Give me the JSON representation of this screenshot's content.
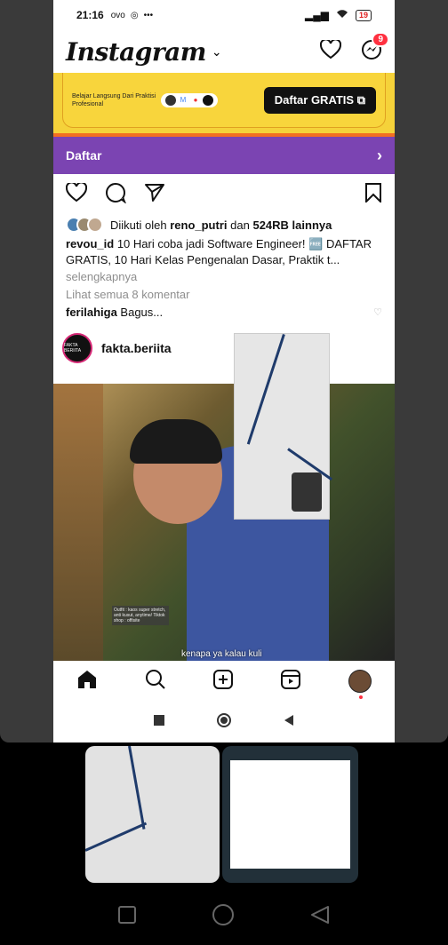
{
  "status_bar": {
    "time": "21:16",
    "carrier_icons": "ovo",
    "more": "•••",
    "battery": "19"
  },
  "header": {
    "logo": "Instagram",
    "messages_badge": "9"
  },
  "ad": {
    "tagline": "Belajar Langsung Dari Praktisi Profesional",
    "cta": "Daftar GRATIS"
  },
  "daftar_bar": {
    "label": "Daftar"
  },
  "post": {
    "liked_prefix": "Diikuti oleh",
    "liked_user": "reno_putri",
    "liked_mid": "dan",
    "liked_count": "524RB lainnya",
    "caption_user": "revou_id",
    "caption_text": "10 Hari coba jadi Software Engineer! 🆓 DAFTAR GRATIS, 10 Hari Kelas Pengenalan Dasar, Praktik t...",
    "more": "selengkapnya",
    "view_comments": "Lihat semua 8 komentar",
    "comment_user": "ferilahiga",
    "comment_text": "Bagus..."
  },
  "next_post": {
    "username": "fakta.beriita",
    "avatar_text": "FAKTA BERIITA",
    "video_subtitle": "kenapa ya kalau kuli",
    "video_sticker": "Outfit : kaos super stretch, anti kusut, anytime/ Tiktok shop : offisite"
  },
  "colors": {
    "ad_yellow": "#f5d23a",
    "ad_orange": "#f36e21",
    "daftar_purple": "#7b44b2",
    "badge_red": "#ff3040"
  }
}
